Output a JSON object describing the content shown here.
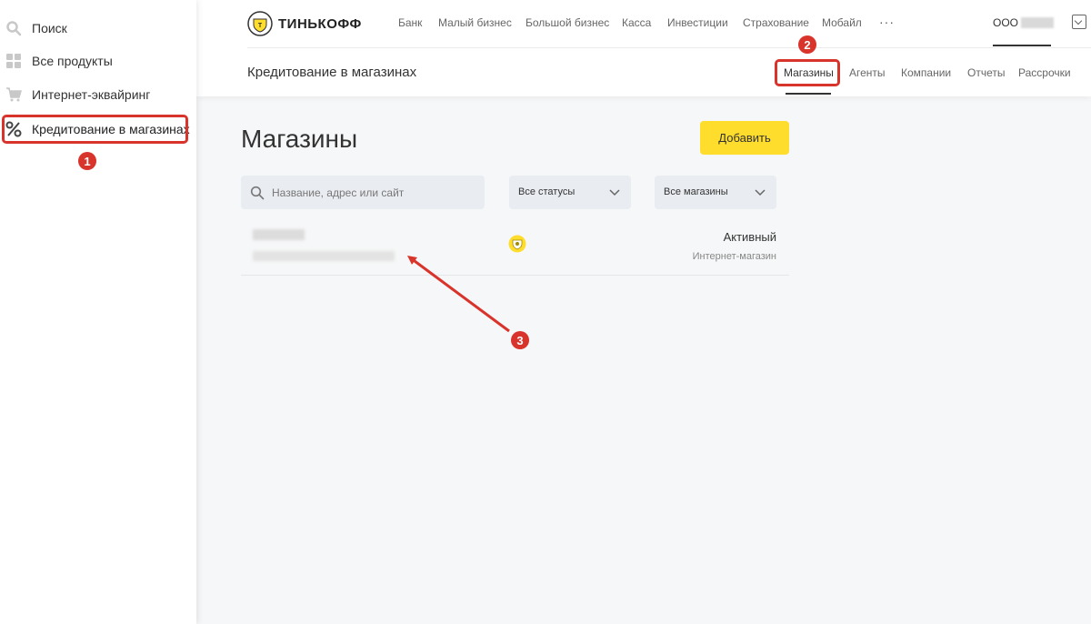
{
  "sidebar": {
    "items": [
      {
        "label": "Поиск",
        "icon": "search-icon"
      },
      {
        "label": "Все продукты",
        "icon": "grid-icon"
      },
      {
        "label": "Интернет-эквайринг",
        "icon": "cart-icon"
      },
      {
        "label": "Кредитование в магазинах",
        "icon": "percent-icon",
        "active": true
      }
    ]
  },
  "header": {
    "logo_text": "ТИНЬКОФФ",
    "nav": [
      "Банк",
      "Малый бизнес",
      "Большой бизнес",
      "Касса",
      "Инвестиции",
      "Страхование",
      "Мобайл"
    ],
    "more_label": "···",
    "org_prefix": "ООО",
    "section_title": "Кредитование в магазинах",
    "subtabs": [
      "Магазины",
      "Агенты",
      "Компании",
      "Отчеты",
      "Рассрочки"
    ]
  },
  "content": {
    "page_title": "Магазины",
    "add_button": "Добавить",
    "search_placeholder": "Название, адрес или сайт",
    "status_filter": "Все статусы",
    "store_filter": "Все магазины",
    "rows": [
      {
        "status": "Активный",
        "type": "Интернет-магазин"
      }
    ]
  },
  "annotations": [
    "1",
    "2",
    "3"
  ],
  "colors": {
    "brand_yellow": "#ffdd2d",
    "annotation_red": "#d9342b",
    "input_bg": "#e9ecf1"
  }
}
